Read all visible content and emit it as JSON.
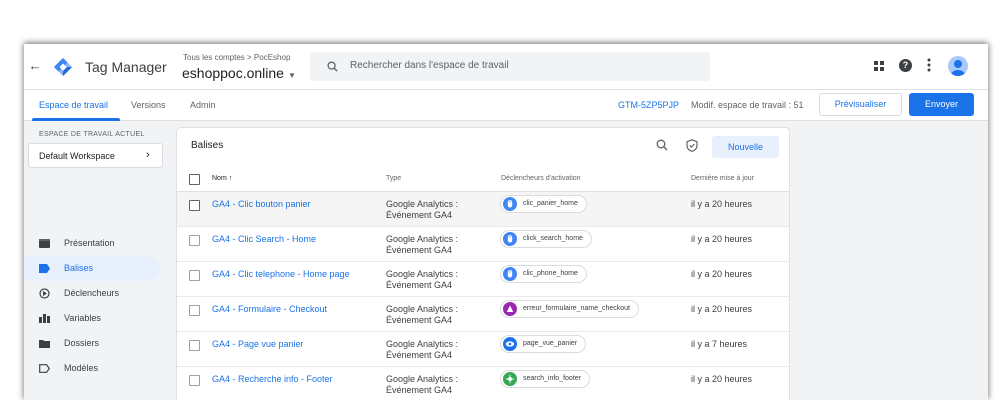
{
  "header": {
    "app_name": "Tag Manager",
    "breadcrumb": "Tous les comptes > PocEshop",
    "container_name": "eshoppoc.online",
    "search_placeholder": "Rechercher dans l'espace de travail"
  },
  "nav": {
    "tabs": [
      {
        "label": "Espace de travail",
        "active": true
      },
      {
        "label": "Versions",
        "active": false
      },
      {
        "label": "Admin",
        "active": false
      }
    ],
    "container_id": "GTM-5ZP5PJP",
    "workspace_changes": "Modif. espace de travail : 51",
    "preview_label": "Prévisualiser",
    "submit_label": "Envoyer"
  },
  "sidebar": {
    "workspace_label": "ESPACE DE TRAVAIL ACTUEL",
    "workspace_name": "Default Workspace",
    "items": [
      {
        "label": "Présentation",
        "icon": "overview-icon",
        "active": false
      },
      {
        "label": "Balises",
        "icon": "tag-icon",
        "active": true
      },
      {
        "label": "Déclencheurs",
        "icon": "trigger-icon",
        "active": false
      },
      {
        "label": "Variables",
        "icon": "variables-icon",
        "active": false
      },
      {
        "label": "Dossiers",
        "icon": "folder-icon",
        "active": false
      },
      {
        "label": "Modèles",
        "icon": "template-icon",
        "active": false
      }
    ]
  },
  "tags_panel": {
    "title": "Balises",
    "new_label": "Nouvelle",
    "columns": {
      "name": "Nom ↑",
      "type": "Type",
      "triggers": "Déclencheurs d'activation",
      "last_edited": "Dernière mise à jour"
    },
    "rows": [
      {
        "name": "GA4 - Clic bouton panier",
        "type_line1": "Google Analytics :",
        "type_line2": "Événement GA4",
        "trigger": "clic_panier_home",
        "trigger_icon": "click-icon",
        "trigger_color": "#4285f4",
        "date": "il y a 20 heures"
      },
      {
        "name": "GA4 - Clic Search - Home",
        "type_line1": "Google Analytics :",
        "type_line2": "Événement GA4",
        "trigger": "click_search_home",
        "trigger_icon": "click-icon",
        "trigger_color": "#4285f4",
        "date": "il y a 20 heures"
      },
      {
        "name": "GA4 - Clic telephone - Home page",
        "type_line1": "Google Analytics :",
        "type_line2": "Événement GA4",
        "trigger": "clic_phone_home",
        "trigger_icon": "click-icon",
        "trigger_color": "#4285f4",
        "date": "il y a 20 heures"
      },
      {
        "name": "GA4 - Formulaire - Checkout",
        "type_line1": "Google Analytics :",
        "type_line2": "Événement GA4",
        "trigger": "erreur_formulaire_name_checkout",
        "trigger_icon": "custom-event-icon",
        "trigger_color": "#9c27b0",
        "date": "il y a 20 heures"
      },
      {
        "name": "GA4 - Page vue panier",
        "type_line1": "Google Analytics :",
        "type_line2": "Événement GA4",
        "trigger": "page_vue_panier",
        "trigger_icon": "pageview-icon",
        "trigger_color": "#1a73e8",
        "date": "il y a 7 heures"
      },
      {
        "name": "GA4 - Recherche info - Footer",
        "type_line1": "Google Analytics :",
        "type_line2": "Événement GA4",
        "trigger": "search_info_footer",
        "trigger_icon": "visibility-icon",
        "trigger_color": "#34a853",
        "date": "il y a 20 heures"
      }
    ]
  }
}
